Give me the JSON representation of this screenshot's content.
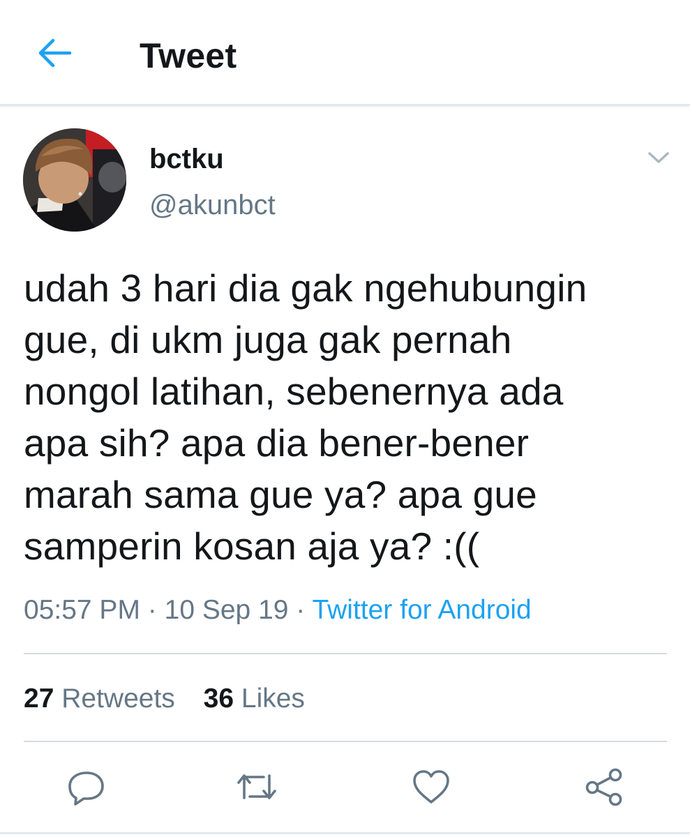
{
  "topbar": {
    "back_icon": "arrow-left-icon",
    "title": "Tweet"
  },
  "colors": {
    "accent": "#1da1f2",
    "text_primary": "#14171a",
    "text_secondary": "#657786",
    "divider": "#d3dbe2"
  },
  "tweet": {
    "author_name": "bctku",
    "author_handle": "@akunbct",
    "more_icon": "chevron-down-icon",
    "text": "udah 3 hari dia gak ngehubungin\ngue, di ukm juga gak pernah\nnongol latihan, sebenernya ada\napa sih? apa dia bener-bener\nmarah sama gue ya? apa gue\nsamperin kosan aja ya? :((",
    "time": "05:57 PM",
    "date": "10 Sep 19",
    "separator": "·",
    "source": "Twitter for Android"
  },
  "stats": {
    "retweets_count": "27",
    "retweets_label": "Retweets",
    "likes_count": "36",
    "likes_label": "Likes"
  },
  "actions": [
    {
      "icon": "reply-icon"
    },
    {
      "icon": "retweet-icon"
    },
    {
      "icon": "heart-icon"
    },
    {
      "icon": "share-icon"
    }
  ]
}
